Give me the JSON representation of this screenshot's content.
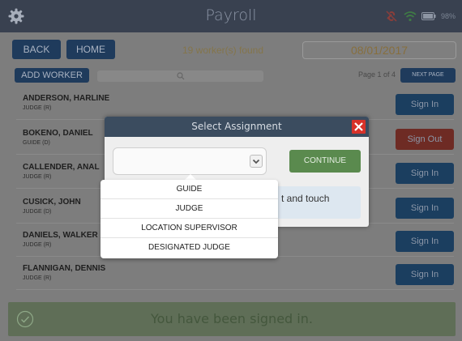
{
  "header": {
    "title": "Payroll",
    "battery_text": "98%",
    "icons": [
      "gear-icon",
      "link-off-icon",
      "wifi-icon",
      "battery-icon"
    ]
  },
  "toolbar": {
    "back_label": "BACK",
    "home_label": "HOME",
    "found_text": "19 worker(s) found",
    "date": "08/01/2017"
  },
  "actions": {
    "add_worker_label": "ADD WORKER",
    "page_info": "Page 1 of 4",
    "next_page_label": "NEXT PAGE"
  },
  "workers": [
    {
      "name": "ANDERSON, HARLINE",
      "role": "JUDGE (R)",
      "action": "Sign In"
    },
    {
      "name": "BOKENO, DANIEL",
      "role": "GUIDE (D)",
      "action": "Sign Out"
    },
    {
      "name": "CALLENDER, ANAL",
      "role": "JUDGE (R)",
      "action": "Sign In"
    },
    {
      "name": "CUSICK, JOHN",
      "role": "JUDGE (D)",
      "action": "Sign In"
    },
    {
      "name": "DANIELS, WALKER",
      "role": "JUDGE (R)",
      "action": "Sign In"
    },
    {
      "name": "FLANNIGAN, DENNIS",
      "role": "JUDGE (R)",
      "action": "Sign In"
    }
  ],
  "modal": {
    "title": "Select Assignment",
    "continue_label": "CONTINUE",
    "hint_fragment": "t and touch"
  },
  "dropdown": {
    "options": [
      "GUIDE",
      "JUDGE",
      "LOCATION SUPERVISOR",
      "DESIGNATED JUDGE"
    ]
  },
  "toast": {
    "message": "You have been signed in."
  },
  "colors": {
    "header_bg": "#394150",
    "sign_in": "#1b3e5f",
    "sign_out": "#6e2b24",
    "continue": "#5a8a4e",
    "close": "#d8322a",
    "toast_bg": "#5f6e57"
  }
}
